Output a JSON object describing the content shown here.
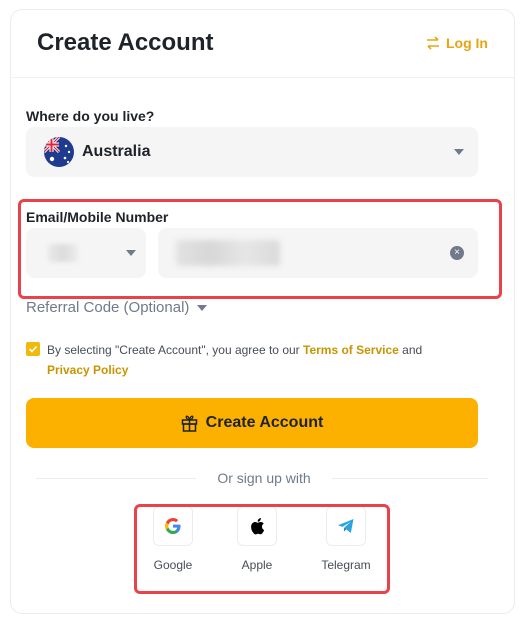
{
  "header": {
    "title": "Create Account",
    "login_label": "Log In"
  },
  "country": {
    "label": "Where do you live?",
    "value": "Australia"
  },
  "contact": {
    "label": "Email/Mobile Number"
  },
  "referral": {
    "label": "Referral Code (Optional)"
  },
  "terms": {
    "prefix": "By selecting \"Create Account\", you agree to our ",
    "terms_link": "Terms of Service",
    "and": " and",
    "privacy_link": "Privacy Policy"
  },
  "create_button": {
    "label": "Create Account"
  },
  "signup": {
    "divider": "Or sign up with",
    "providers": [
      "Google",
      "Apple",
      "Telegram"
    ]
  },
  "colors": {
    "accent": "#fcb000",
    "link": "#c99400",
    "highlight": "#e8424a"
  }
}
